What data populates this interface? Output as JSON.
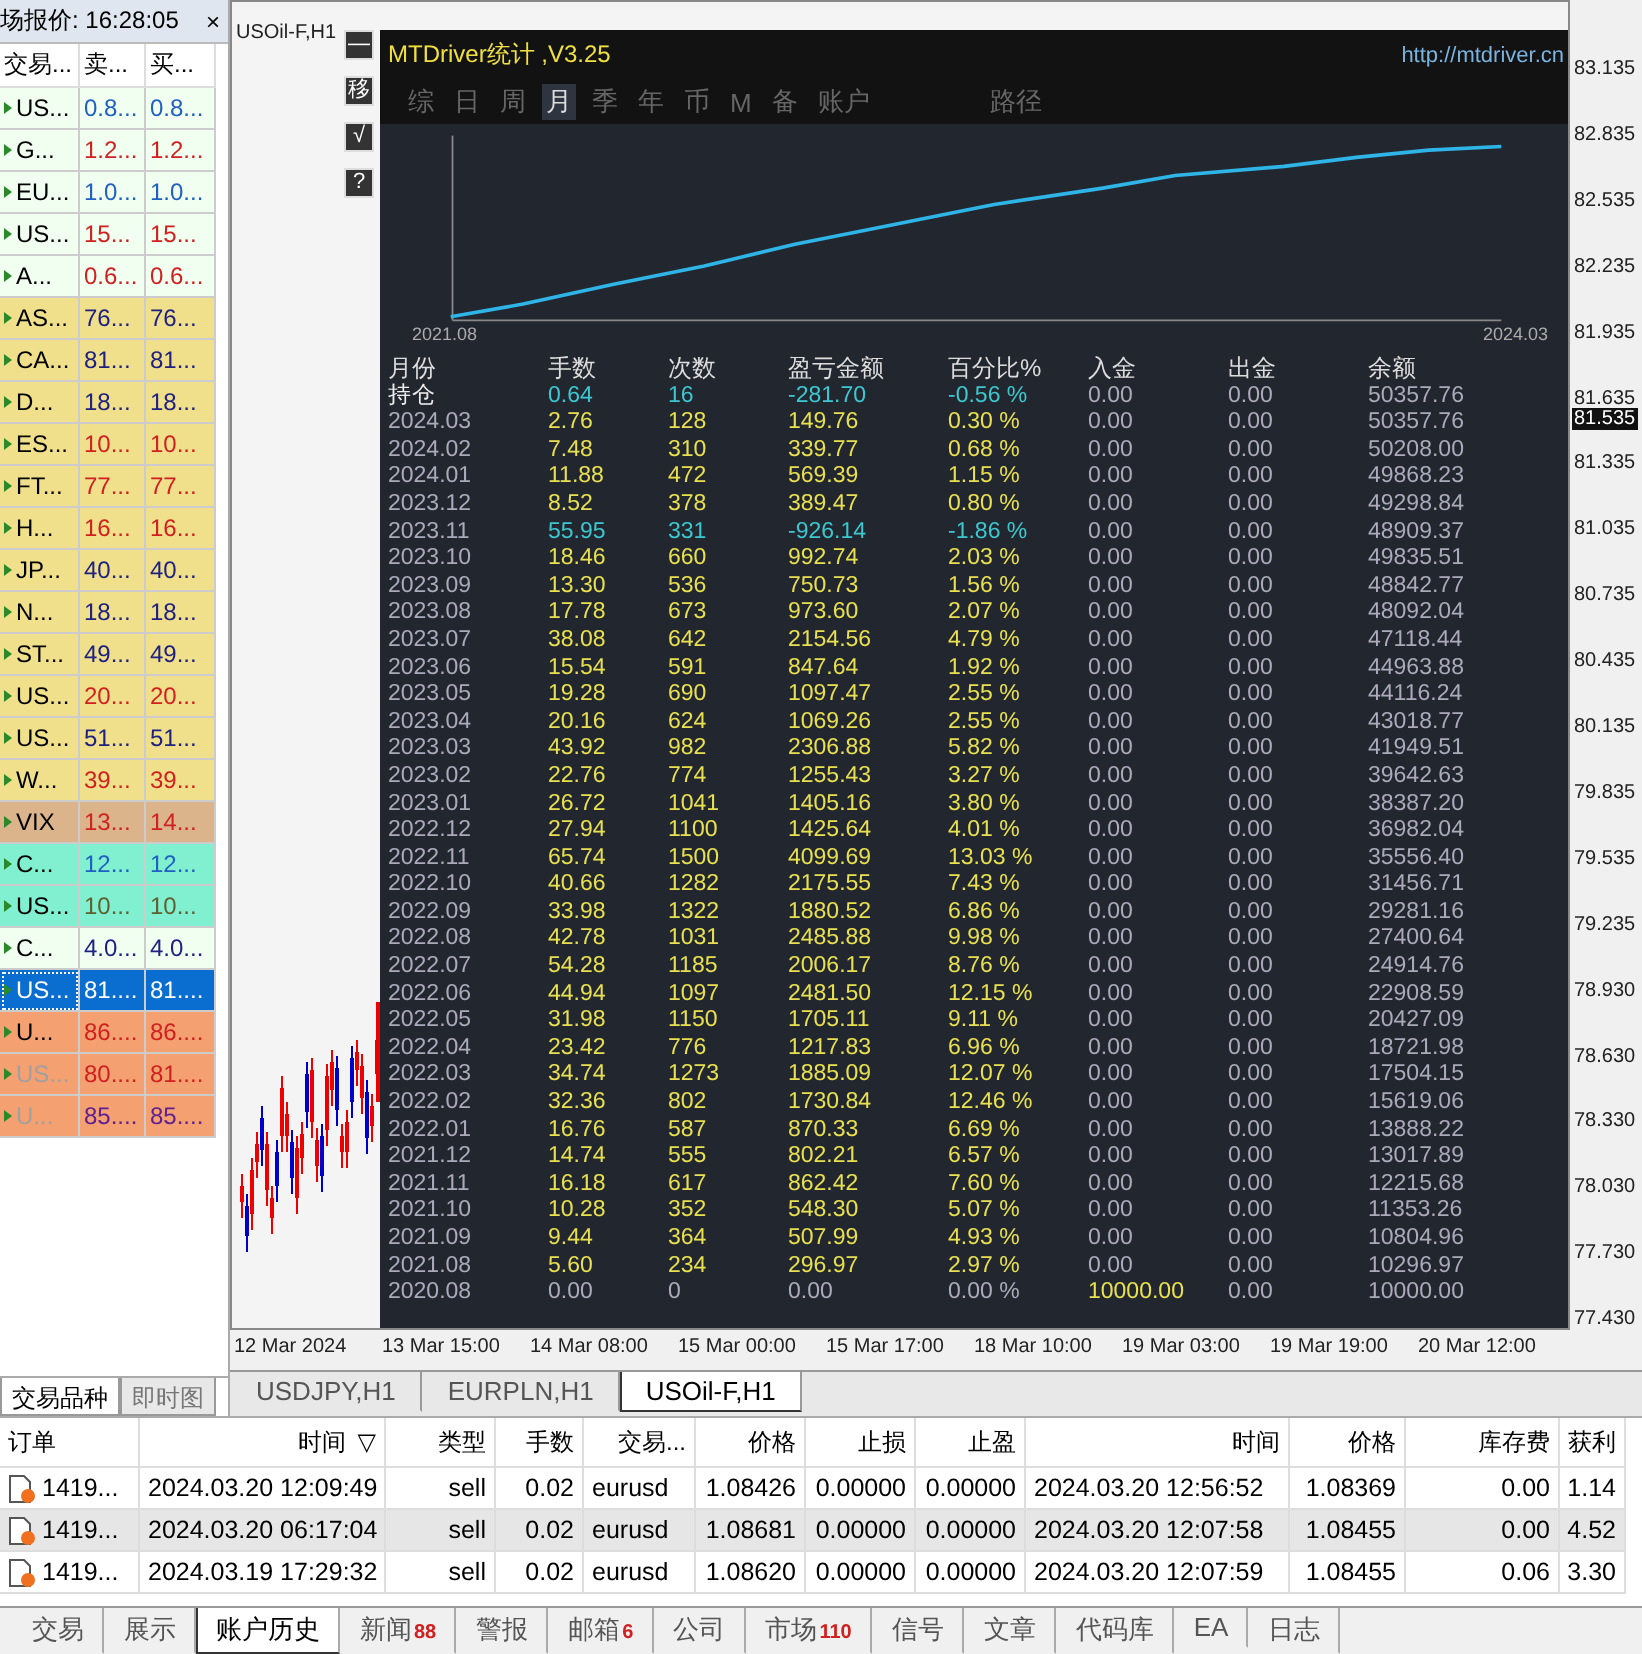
{
  "market_watch": {
    "title": "场报价: 16:28:05",
    "close": "×",
    "columns": [
      "交易...",
      "卖...",
      "买..."
    ],
    "rows": [
      {
        "symbol": "US...",
        "bid": "0.8...",
        "ask": "0.8...",
        "color": "#f0fff0",
        "kind": "flat",
        "selected": false,
        "disabled": false
      },
      {
        "symbol": "G...",
        "bid": "1.2...",
        "ask": "1.2...",
        "color": "#f0fff0",
        "kind": "up",
        "selected": false,
        "disabled": false
      },
      {
        "symbol": "EU...",
        "bid": "1.0...",
        "ask": "1.0...",
        "color": "#f0fff0",
        "kind": "flat",
        "selected": false,
        "disabled": false
      },
      {
        "symbol": "US...",
        "bid": "15...",
        "ask": "15...",
        "color": "#f0fff0",
        "kind": "up",
        "selected": false,
        "disabled": false
      },
      {
        "symbol": "A...",
        "bid": "0.6...",
        "ask": "0.6...",
        "color": "#f0fff0",
        "kind": "up",
        "selected": false,
        "disabled": false
      },
      {
        "symbol": "AS...",
        "bid": "76...",
        "ask": "76...",
        "color": "#f0e08c",
        "kind": "down",
        "selected": false,
        "disabled": false
      },
      {
        "symbol": "CA...",
        "bid": "81...",
        "ask": "81...",
        "color": "#f0e08c",
        "kind": "down",
        "selected": false,
        "disabled": false
      },
      {
        "symbol": "D...",
        "bid": "18...",
        "ask": "18...",
        "color": "#f0e08c",
        "kind": "down",
        "selected": false,
        "disabled": false
      },
      {
        "symbol": "ES...",
        "bid": "10...",
        "ask": "10...",
        "color": "#f0e08c",
        "kind": "up",
        "selected": false,
        "disabled": false
      },
      {
        "symbol": "FT...",
        "bid": "77...",
        "ask": "77...",
        "color": "#f0e08c",
        "kind": "up",
        "selected": false,
        "disabled": false
      },
      {
        "symbol": "H...",
        "bid": "16...",
        "ask": "16...",
        "color": "#f0e08c",
        "kind": "up",
        "selected": false,
        "disabled": false
      },
      {
        "symbol": "JP...",
        "bid": "40...",
        "ask": "40...",
        "color": "#f0e08c",
        "kind": "down",
        "selected": false,
        "disabled": false
      },
      {
        "symbol": "N...",
        "bid": "18...",
        "ask": "18...",
        "color": "#f0e08c",
        "kind": "down",
        "selected": false,
        "disabled": false
      },
      {
        "symbol": "ST...",
        "bid": "49...",
        "ask": "49...",
        "color": "#f0e08c",
        "kind": "down",
        "selected": false,
        "disabled": false
      },
      {
        "symbol": "US...",
        "bid": "20...",
        "ask": "20...",
        "color": "#f0e08c",
        "kind": "up",
        "selected": false,
        "disabled": false
      },
      {
        "symbol": "US...",
        "bid": "51...",
        "ask": "51...",
        "color": "#f0e08c",
        "kind": "down",
        "selected": false,
        "disabled": false
      },
      {
        "symbol": "W...",
        "bid": "39...",
        "ask": "39...",
        "color": "#f0e08c",
        "kind": "up",
        "selected": false,
        "disabled": false
      },
      {
        "symbol": "VIX",
        "bid": "13...",
        "ask": "14...",
        "color": "#dcb48c",
        "kind": "up",
        "selected": false,
        "disabled": false
      },
      {
        "symbol": "C...",
        "bid": "12...",
        "ask": "12...",
        "color": "#80f0d0",
        "kind": "flat",
        "selected": false,
        "disabled": false
      },
      {
        "symbol": "US...",
        "bid": "10...",
        "ask": "10...",
        "color": "#80f0d0",
        "kind": "still",
        "selected": false,
        "disabled": false
      },
      {
        "symbol": "C...",
        "bid": "4.0...",
        "ask": "4.0...",
        "color": "#f0fff0",
        "kind": "down",
        "selected": false,
        "disabled": false
      },
      {
        "symbol": "US...",
        "bid": "81....",
        "ask": "81....",
        "color": "#0a6ed1",
        "selected": true,
        "disabled": false
      },
      {
        "symbol": "U...",
        "bid": "86....",
        "ask": "86....",
        "color": "#f4a070",
        "kind": "up",
        "selected": false,
        "disabled": false
      },
      {
        "symbol": "US...",
        "bid": "80....",
        "ask": "81....",
        "color": "#f4a070",
        "kind": "up",
        "selected": false,
        "disabled": true
      },
      {
        "symbol": "U...",
        "bid": "85....",
        "ask": "85....",
        "color": "#f4a070",
        "kind": "other",
        "selected": false,
        "disabled": true
      }
    ],
    "tabs": [
      {
        "label": "交易品种",
        "selected": true
      },
      {
        "label": "即时图",
        "selected": false
      }
    ]
  },
  "chart": {
    "title": "USOil-F,H1",
    "side_buttons": [
      "—",
      "移",
      "√",
      "?"
    ],
    "price_axis": [
      {
        "label": "83.135",
        "current": false
      },
      {
        "label": "82.835",
        "current": false
      },
      {
        "label": "82.535",
        "current": false
      },
      {
        "label": "82.235",
        "current": false
      },
      {
        "label": "81.935",
        "current": false
      },
      {
        "label": "81.635",
        "current": false
      },
      {
        "label": "81.535",
        "current": true
      },
      {
        "label": "81.335",
        "current": false
      },
      {
        "label": "81.035",
        "current": false
      },
      {
        "label": "80.735",
        "current": false
      },
      {
        "label": "80.435",
        "current": false
      },
      {
        "label": "80.135",
        "current": false
      },
      {
        "label": "79.835",
        "current": false
      },
      {
        "label": "79.535",
        "current": false
      },
      {
        "label": "79.235",
        "current": false
      },
      {
        "label": "78.930",
        "current": false
      },
      {
        "label": "78.630",
        "current": false
      },
      {
        "label": "78.330",
        "current": false
      },
      {
        "label": "78.030",
        "current": false
      },
      {
        "label": "77.730",
        "current": false
      },
      {
        "label": "77.430",
        "current": false
      }
    ],
    "time_axis": [
      "12 Mar 2024",
      "13 Mar 15:00",
      "14 Mar 08:00",
      "15 Mar 00:00",
      "15 Mar 17:00",
      "18 Mar 10:00",
      "19 Mar 03:00",
      "19 Mar 19:00",
      "20 Mar 12:00"
    ],
    "tabs": [
      {
        "label": "USDJPY,H1",
        "selected": false
      },
      {
        "label": "EURPLN,H1",
        "selected": false
      },
      {
        "label": "USOil-F,H1",
        "selected": true
      }
    ]
  },
  "stats": {
    "title": "MTDriver统计 ,V3.25",
    "link": "http://mtdriver.cn",
    "tabs": [
      {
        "label": "综",
        "selected": false
      },
      {
        "label": "日",
        "selected": false
      },
      {
        "label": "周",
        "selected": false
      },
      {
        "label": "月",
        "selected": true
      },
      {
        "label": "季",
        "selected": false
      },
      {
        "label": "年",
        "selected": false
      },
      {
        "label": "币",
        "selected": false
      },
      {
        "label": "M",
        "selected": false
      },
      {
        "label": "备",
        "selected": false
      },
      {
        "label": "账户",
        "selected": false
      },
      {
        "label": "路径",
        "selected": false
      }
    ],
    "equity_start": "2021.08",
    "equity_end": "2024.03",
    "columns": [
      "月份",
      "手数",
      "次数",
      "盈亏金额",
      "百分比%",
      "入金",
      "出金",
      "余额"
    ],
    "rows": [
      {
        "kind": "open",
        "cells": [
          "持仓",
          "0.64",
          "16",
          "-281.70",
          "-0.56 %",
          "0.00",
          "0.00",
          "50357.76"
        ]
      },
      {
        "kind": "gain",
        "cells": [
          "2024.03",
          "2.76",
          "128",
          "149.76",
          "0.30 %",
          "0.00",
          "0.00",
          "50357.76"
        ]
      },
      {
        "kind": "gain",
        "cells": [
          "2024.02",
          "7.48",
          "310",
          "339.77",
          "0.68 %",
          "0.00",
          "0.00",
          "50208.00"
        ]
      },
      {
        "kind": "gain",
        "cells": [
          "2024.01",
          "11.88",
          "472",
          "569.39",
          "1.15 %",
          "0.00",
          "0.00",
          "49868.23"
        ]
      },
      {
        "kind": "gain",
        "cells": [
          "2023.12",
          "8.52",
          "378",
          "389.47",
          "0.80 %",
          "0.00",
          "0.00",
          "49298.84"
        ]
      },
      {
        "kind": "loss",
        "cells": [
          "2023.11",
          "55.95",
          "331",
          "-926.14",
          "-1.86 %",
          "0.00",
          "0.00",
          "48909.37"
        ]
      },
      {
        "kind": "gain",
        "cells": [
          "2023.10",
          "18.46",
          "660",
          "992.74",
          "2.03 %",
          "0.00",
          "0.00",
          "49835.51"
        ]
      },
      {
        "kind": "gain",
        "cells": [
          "2023.09",
          "13.30",
          "536",
          "750.73",
          "1.56 %",
          "0.00",
          "0.00",
          "48842.77"
        ]
      },
      {
        "kind": "gain",
        "cells": [
          "2023.08",
          "17.78",
          "673",
          "973.60",
          "2.07 %",
          "0.00",
          "0.00",
          "48092.04"
        ]
      },
      {
        "kind": "gain",
        "cells": [
          "2023.07",
          "38.08",
          "642",
          "2154.56",
          "4.79 %",
          "0.00",
          "0.00",
          "47118.44"
        ]
      },
      {
        "kind": "gain",
        "cells": [
          "2023.06",
          "15.54",
          "591",
          "847.64",
          "1.92 %",
          "0.00",
          "0.00",
          "44963.88"
        ]
      },
      {
        "kind": "gain",
        "cells": [
          "2023.05",
          "19.28",
          "690",
          "1097.47",
          "2.55 %",
          "0.00",
          "0.00",
          "44116.24"
        ]
      },
      {
        "kind": "gain",
        "cells": [
          "2023.04",
          "20.16",
          "624",
          "1069.26",
          "2.55 %",
          "0.00",
          "0.00",
          "43018.77"
        ]
      },
      {
        "kind": "gain",
        "cells": [
          "2023.03",
          "43.92",
          "982",
          "2306.88",
          "5.82 %",
          "0.00",
          "0.00",
          "41949.51"
        ]
      },
      {
        "kind": "gain",
        "cells": [
          "2023.02",
          "22.76",
          "774",
          "1255.43",
          "3.27 %",
          "0.00",
          "0.00",
          "39642.63"
        ]
      },
      {
        "kind": "gain",
        "cells": [
          "2023.01",
          "26.72",
          "1041",
          "1405.16",
          "3.80 %",
          "0.00",
          "0.00",
          "38387.20"
        ]
      },
      {
        "kind": "gain",
        "cells": [
          "2022.12",
          "27.94",
          "1100",
          "1425.64",
          "4.01 %",
          "0.00",
          "0.00",
          "36982.04"
        ]
      },
      {
        "kind": "gain",
        "cells": [
          "2022.11",
          "65.74",
          "1500",
          "4099.69",
          "13.03 %",
          "0.00",
          "0.00",
          "35556.40"
        ]
      },
      {
        "kind": "gain",
        "cells": [
          "2022.10",
          "40.66",
          "1282",
          "2175.55",
          "7.43 %",
          "0.00",
          "0.00",
          "31456.71"
        ]
      },
      {
        "kind": "gain",
        "cells": [
          "2022.09",
          "33.98",
          "1322",
          "1880.52",
          "6.86 %",
          "0.00",
          "0.00",
          "29281.16"
        ]
      },
      {
        "kind": "gain",
        "cells": [
          "2022.08",
          "42.78",
          "1031",
          "2485.88",
          "9.98 %",
          "0.00",
          "0.00",
          "27400.64"
        ]
      },
      {
        "kind": "gain",
        "cells": [
          "2022.07",
          "54.28",
          "1185",
          "2006.17",
          "8.76 %",
          "0.00",
          "0.00",
          "24914.76"
        ]
      },
      {
        "kind": "gain",
        "cells": [
          "2022.06",
          "44.94",
          "1097",
          "2481.50",
          "12.15 %",
          "0.00",
          "0.00",
          "22908.59"
        ]
      },
      {
        "kind": "gain",
        "cells": [
          "2022.05",
          "31.98",
          "1150",
          "1705.11",
          "9.11 %",
          "0.00",
          "0.00",
          "20427.09"
        ]
      },
      {
        "kind": "gain",
        "cells": [
          "2022.04",
          "23.42",
          "776",
          "1217.83",
          "6.96 %",
          "0.00",
          "0.00",
          "18721.98"
        ]
      },
      {
        "kind": "gain",
        "cells": [
          "2022.03",
          "34.74",
          "1273",
          "1885.09",
          "12.07 %",
          "0.00",
          "0.00",
          "17504.15"
        ]
      },
      {
        "kind": "gain",
        "cells": [
          "2022.02",
          "32.36",
          "802",
          "1730.84",
          "12.46 %",
          "0.00",
          "0.00",
          "15619.06"
        ]
      },
      {
        "kind": "gain",
        "cells": [
          "2022.01",
          "16.76",
          "587",
          "870.33",
          "6.69 %",
          "0.00",
          "0.00",
          "13888.22"
        ]
      },
      {
        "kind": "gain",
        "cells": [
          "2021.12",
          "14.74",
          "555",
          "802.21",
          "6.57 %",
          "0.00",
          "0.00",
          "13017.89"
        ]
      },
      {
        "kind": "gain",
        "cells": [
          "2021.11",
          "16.18",
          "617",
          "862.42",
          "7.60 %",
          "0.00",
          "0.00",
          "12215.68"
        ]
      },
      {
        "kind": "gain",
        "cells": [
          "2021.10",
          "10.28",
          "352",
          "548.30",
          "5.07 %",
          "0.00",
          "0.00",
          "11353.26"
        ]
      },
      {
        "kind": "gain",
        "cells": [
          "2021.09",
          "9.44",
          "364",
          "507.99",
          "4.93 %",
          "0.00",
          "0.00",
          "10804.96"
        ]
      },
      {
        "kind": "gain",
        "cells": [
          "2021.08",
          "5.60",
          "234",
          "296.97",
          "2.97 %",
          "0.00",
          "0.00",
          "10296.97"
        ]
      },
      {
        "kind": "deposit",
        "cells": [
          "2020.08",
          "0.00",
          "0",
          "0.00",
          "0.00 %",
          "10000.00",
          "0.00",
          "10000.00"
        ]
      }
    ]
  },
  "history": {
    "columns": [
      {
        "label": "订单"
      },
      {
        "label": "时间",
        "sort": "▽"
      },
      {
        "label": "类型"
      },
      {
        "label": "手数"
      },
      {
        "label": "交易..."
      },
      {
        "label": "价格"
      },
      {
        "label": "止损"
      },
      {
        "label": "止盈"
      },
      {
        "label": "时间"
      },
      {
        "label": "价格"
      },
      {
        "label": "库存费"
      },
      {
        "label": "获利"
      }
    ],
    "rows": [
      {
        "selected": false,
        "cells": [
          "1419...",
          "2024.03.20 12:09:49",
          "sell",
          "0.02",
          "eurusd",
          "1.08426",
          "0.00000",
          "0.00000",
          "2024.03.20 12:56:52",
          "1.08369",
          "0.00",
          "1.14"
        ]
      },
      {
        "selected": true,
        "cells": [
          "1419...",
          "2024.03.20 06:17:04",
          "sell",
          "0.02",
          "eurusd",
          "1.08681",
          "0.00000",
          "0.00000",
          "2024.03.20 12:07:58",
          "1.08455",
          "0.00",
          "4.52"
        ]
      },
      {
        "selected": false,
        "cells": [
          "1419...",
          "2024.03.19 17:29:32",
          "sell",
          "0.02",
          "eurusd",
          "1.08620",
          "0.00000",
          "0.00000",
          "2024.03.20 12:07:59",
          "1.08455",
          "0.06",
          "3.30"
        ]
      }
    ]
  },
  "terminal_tabs": [
    {
      "label": "交易",
      "selected": false
    },
    {
      "label": "展示",
      "selected": false
    },
    {
      "label": "账户历史",
      "selected": true
    },
    {
      "label": "新闻",
      "count": "88",
      "selected": false
    },
    {
      "label": "警报",
      "selected": false
    },
    {
      "label": "邮箱",
      "count": "6",
      "selected": false
    },
    {
      "label": "公司",
      "selected": false
    },
    {
      "label": "市场",
      "count": "110",
      "selected": false
    },
    {
      "label": "信号",
      "selected": false
    },
    {
      "label": "文章",
      "selected": false
    },
    {
      "label": "代码库",
      "selected": false
    },
    {
      "label": "EA",
      "selected": false
    },
    {
      "label": "日志",
      "selected": false
    }
  ]
}
